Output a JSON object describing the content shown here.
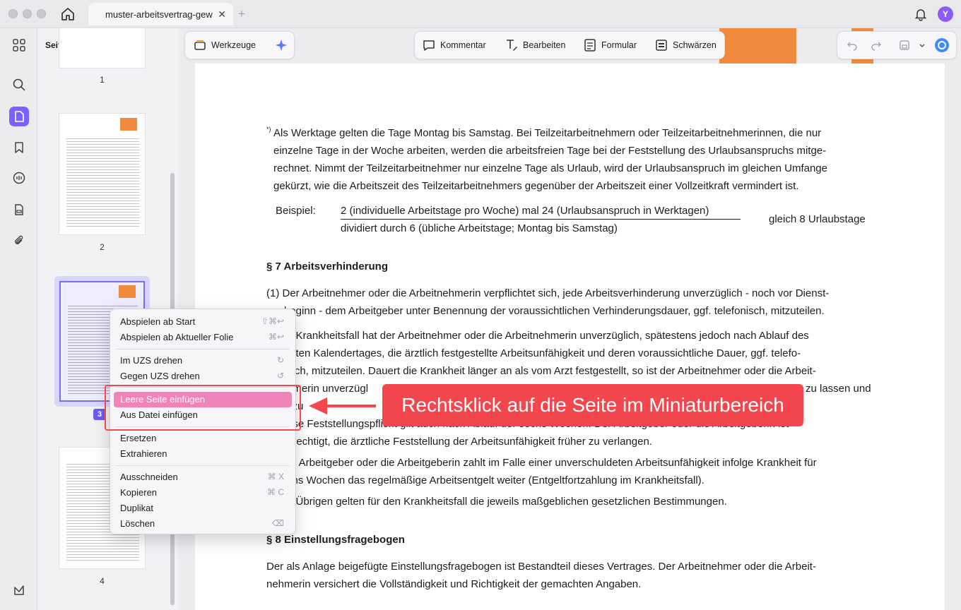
{
  "titlebar": {
    "tab_title": "muster-arbeitsvertrag-gew",
    "tab_close": "✕",
    "tab_add": "+",
    "avatar_letter": "Y"
  },
  "thumbnails": {
    "title": "Seitenminiaturen",
    "pages": [
      {
        "number": "1"
      },
      {
        "number": "2"
      },
      {
        "number": "3"
      },
      {
        "number": "4"
      }
    ]
  },
  "toolbar": {
    "tools_label": "Werkzeuge",
    "comment_label": "Kommentar",
    "edit_label": "Bearbeiten",
    "form_label": "Formular",
    "redact_label": "Schwärzen"
  },
  "document": {
    "footnote_mark": "*)",
    "para1": [
      "Als Werktage gelten die Tage Montag bis Samstag. Bei Teilzeitarbeitnehmern oder Teilzeitarbeitnehmerinnen, die nur",
      "einzelne Tage in der Woche arbeiten, werden die arbeitsfreien Tage bei der Feststellung des Urlaubsanspruchs mitge-",
      "rechnet. Nimmt der Teilzeitarbeitnehmer nur einzelne Tage als Urlaub, wird der Urlaubsanspruch im gleichen Umfange",
      "gekürzt, wie die Arbeitszeit des Teilzeitarbeitnehmers gegenüber der Arbeitszeit einer Vollzeitkraft vermindert ist."
    ],
    "example_label": "Beispiel:",
    "example_numerator": "2 (individuelle Arbeitstage pro Woche) mal 24 (Urlaubsanspruch in Werktagen)",
    "example_denominator": "dividiert durch 6 (übliche Arbeitstage; Montag bis Samstag)",
    "example_result": "gleich 8 Urlaubstage",
    "section7_heading": "§ 7 Arbeitsverhinderung",
    "s7_lines": [
      "(1)  Der Arbeitnehmer oder die Arbeitnehmerin verpflichtet sich, jede Arbeitsverhinderung unverzüglich - noch vor Dienst-",
      "beginn - dem Arbeitgeber unter Benennung der voraussichtlichen Verhinderungsdauer, ggf. telefonisch, mitzuteilen.",
      "n Krankheitsfall hat der Arbeitnehmer oder die Arbeitnehmerin unverzüglich, spätestens jedoch nach Ablauf des",
      "ritten Kalendertages, die ärztlich festgestellte Arbeitsunfähigkeit und deren voraussichtliche Dauer, ggf. telefo-",
      "isch, mitzuteilen. Dauert die Krankheit länger an als vom Arzt festgestellt, so ist der Arbeitnehmer oder die Arbeit-",
      "hmerin unverzügl",
      "zu lassen und",
      "itzu",
      "ese Feststellungspflicht gilt auch nach Ablauf der sechs Wochen. Der Arbeitgeber oder die Arbeitgeberin ist",
      "erechtigt, die ärztliche Feststellung der Arbeitsunfähigkeit  früher zu verlangen.",
      "er Arbeitgeber oder die Arbeitgeberin zahlt im Falle einer unverschuldeten Arbeitsunfähigkeit infolge Krankheit für",
      "chs Wochen das regelmäßige Arbeitsentgelt weiter (Entgeltfortzahlung im Krankheitsfall).",
      "n Übrigen gelten für den Krankheitsfall die jeweils maßgeblichen gesetzlichen Bestimmungen."
    ],
    "section8_heading": "§ 8 Einstellungsfragebogen",
    "s8_lines": [
      "Der als Anlage beigefügte Einstellungsfragebogen ist Bestandteil dieses Vertrages. Der Arbeitnehmer oder die Arbeit-",
      "nehmerin versichert die Vollständigkeit und Richtigkeit der gemachten Angaben."
    ]
  },
  "context_menu": {
    "items": [
      {
        "label": "Abspielen ab Start",
        "shortcut": "⇧⌘↩"
      },
      {
        "label": "Abspielen ab Aktueller Folie",
        "shortcut": "⌘↩"
      },
      {
        "label": "Im UZS drehen",
        "shortcut": "↻"
      },
      {
        "label": "Gegen UZS drehen",
        "shortcut": "↺"
      },
      {
        "label": "Leere Seite einfügen",
        "shortcut": ""
      },
      {
        "label": "Aus Datei einfügen",
        "shortcut": ""
      },
      {
        "label": "Ersetzen",
        "shortcut": ""
      },
      {
        "label": "Extrahieren",
        "shortcut": ""
      },
      {
        "label": "Ausschneiden",
        "shortcut": "⌘ X"
      },
      {
        "label": "Kopieren",
        "shortcut": "⌘ C"
      },
      {
        "label": "Duplikat",
        "shortcut": ""
      },
      {
        "label": "Löschen",
        "shortcut": "⌫"
      }
    ]
  },
  "callout": {
    "text": "Rechtsklick auf die Seite im Miniaturbereich"
  },
  "colors": {
    "accent": "#7b61ff",
    "highlight": "#f084b8",
    "callout_red": "#f3474d",
    "brand_orange": "#f08a3c"
  }
}
